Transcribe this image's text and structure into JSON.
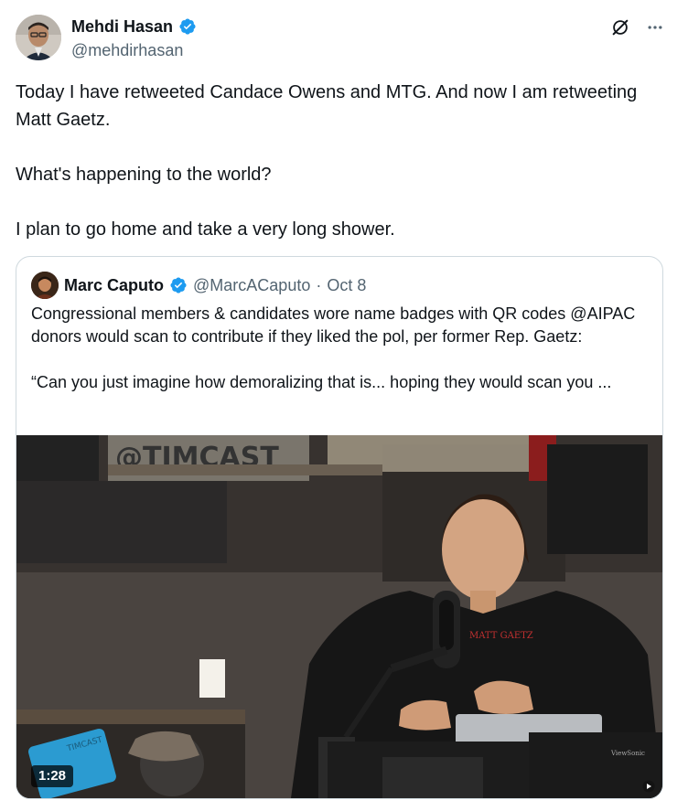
{
  "author": {
    "name": "Mehdi Hasan",
    "handle": "@mehdirhasan",
    "verified": true,
    "avatar_icon": "author-avatar"
  },
  "header_icons": [
    "grok-icon",
    "more-icon"
  ],
  "tweet_text": "Today I have retweeted Candace Owens and MTG. And now I am retweeting Matt Gaetz.\n\nWhat's happening to the world?\n\nI plan to go home and take a very long shower.",
  "quote": {
    "name": "Marc Caputo",
    "handle": "@MarcACaputo",
    "dot": "·",
    "date": "Oct 8",
    "verified": true,
    "text": "Congressional members & candidates wore name badges with QR codes @AIPAC donors would scan to contribute if they liked the pol, per former Rep. Gaetz:\n\n“Can you just imagine how demoralizing that is... hoping they would scan you ...",
    "media": {
      "type": "video",
      "duration": "1:28",
      "sign_text": "@TIMCAST",
      "shirt_text": "MATT GAETZ",
      "monitor_brand": "ViewSonic"
    }
  },
  "colors": {
    "verified_blue": "#1d9bf0",
    "text_primary": "#0f1419",
    "text_secondary": "#536471",
    "border": "#cfd9de"
  }
}
